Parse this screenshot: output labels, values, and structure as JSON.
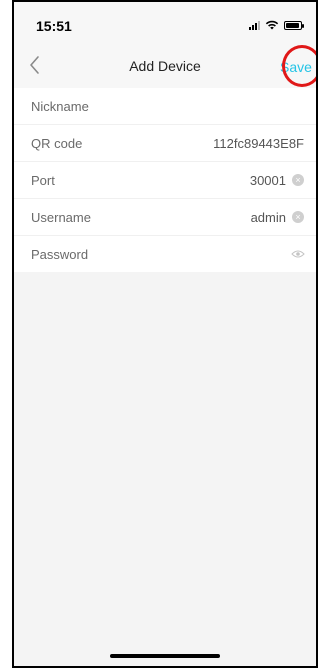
{
  "status": {
    "time": "15:51"
  },
  "nav": {
    "title": "Add Device",
    "save_label": "Save",
    "accent": "#25c4e6"
  },
  "form": {
    "nickname": {
      "label": "Nickname",
      "value": ""
    },
    "qr": {
      "label": "QR code",
      "value": "112fc89443E8F"
    },
    "port": {
      "label": "Port",
      "value": "30001"
    },
    "username": {
      "label": "Username",
      "value": "admin"
    },
    "password": {
      "label": "Password",
      "value": ""
    }
  },
  "icons": {
    "back": "chevron-left-icon",
    "clear": "clear-circle-icon",
    "eye": "eye-icon"
  }
}
